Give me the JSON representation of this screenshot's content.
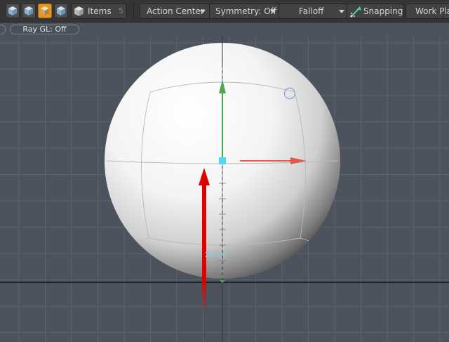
{
  "toolbar": {
    "items_label": "Items",
    "items_shortcut": "5",
    "action_center": "Action Center",
    "symmetry": "Symmetry: Off",
    "falloff": "Falloff",
    "snapping": "Snapping",
    "work_plane": "Work Plane"
  },
  "subbar": {
    "ray_gl": "Ray GL: Off"
  },
  "viewport": {
    "scale_label": "20 um",
    "background_color": "#4c535c",
    "grid_color": "#5b6270",
    "x_axis_color": "#e05a4c",
    "y_axis_color": "#4caa4c",
    "z_axis_color": "#e00000",
    "pivot_color": "#4fd8f0",
    "object": "sphere"
  },
  "colors": {
    "toolbar_bg": "#353535",
    "active_button": "#e8951f"
  }
}
